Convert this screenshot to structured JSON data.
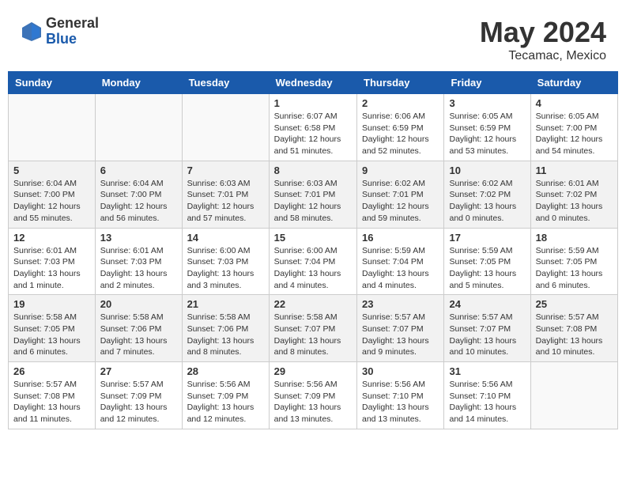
{
  "header": {
    "logo_general": "General",
    "logo_blue": "Blue",
    "month": "May 2024",
    "location": "Tecamac, Mexico"
  },
  "weekdays": [
    "Sunday",
    "Monday",
    "Tuesday",
    "Wednesday",
    "Thursday",
    "Friday",
    "Saturday"
  ],
  "weeks": [
    [
      {
        "day": "",
        "info": "",
        "shaded": false
      },
      {
        "day": "",
        "info": "",
        "shaded": false
      },
      {
        "day": "",
        "info": "",
        "shaded": false
      },
      {
        "day": "1",
        "info": "Sunrise: 6:07 AM\nSunset: 6:58 PM\nDaylight: 12 hours\nand 51 minutes.",
        "shaded": false
      },
      {
        "day": "2",
        "info": "Sunrise: 6:06 AM\nSunset: 6:59 PM\nDaylight: 12 hours\nand 52 minutes.",
        "shaded": false
      },
      {
        "day": "3",
        "info": "Sunrise: 6:05 AM\nSunset: 6:59 PM\nDaylight: 12 hours\nand 53 minutes.",
        "shaded": false
      },
      {
        "day": "4",
        "info": "Sunrise: 6:05 AM\nSunset: 7:00 PM\nDaylight: 12 hours\nand 54 minutes.",
        "shaded": false
      }
    ],
    [
      {
        "day": "5",
        "info": "Sunrise: 6:04 AM\nSunset: 7:00 PM\nDaylight: 12 hours\nand 55 minutes.",
        "shaded": true
      },
      {
        "day": "6",
        "info": "Sunrise: 6:04 AM\nSunset: 7:00 PM\nDaylight: 12 hours\nand 56 minutes.",
        "shaded": true
      },
      {
        "day": "7",
        "info": "Sunrise: 6:03 AM\nSunset: 7:01 PM\nDaylight: 12 hours\nand 57 minutes.",
        "shaded": true
      },
      {
        "day": "8",
        "info": "Sunrise: 6:03 AM\nSunset: 7:01 PM\nDaylight: 12 hours\nand 58 minutes.",
        "shaded": true
      },
      {
        "day": "9",
        "info": "Sunrise: 6:02 AM\nSunset: 7:01 PM\nDaylight: 12 hours\nand 59 minutes.",
        "shaded": true
      },
      {
        "day": "10",
        "info": "Sunrise: 6:02 AM\nSunset: 7:02 PM\nDaylight: 13 hours\nand 0 minutes.",
        "shaded": true
      },
      {
        "day": "11",
        "info": "Sunrise: 6:01 AM\nSunset: 7:02 PM\nDaylight: 13 hours\nand 0 minutes.",
        "shaded": true
      }
    ],
    [
      {
        "day": "12",
        "info": "Sunrise: 6:01 AM\nSunset: 7:03 PM\nDaylight: 13 hours\nand 1 minute.",
        "shaded": false
      },
      {
        "day": "13",
        "info": "Sunrise: 6:01 AM\nSunset: 7:03 PM\nDaylight: 13 hours\nand 2 minutes.",
        "shaded": false
      },
      {
        "day": "14",
        "info": "Sunrise: 6:00 AM\nSunset: 7:03 PM\nDaylight: 13 hours\nand 3 minutes.",
        "shaded": false
      },
      {
        "day": "15",
        "info": "Sunrise: 6:00 AM\nSunset: 7:04 PM\nDaylight: 13 hours\nand 4 minutes.",
        "shaded": false
      },
      {
        "day": "16",
        "info": "Sunrise: 5:59 AM\nSunset: 7:04 PM\nDaylight: 13 hours\nand 4 minutes.",
        "shaded": false
      },
      {
        "day": "17",
        "info": "Sunrise: 5:59 AM\nSunset: 7:05 PM\nDaylight: 13 hours\nand 5 minutes.",
        "shaded": false
      },
      {
        "day": "18",
        "info": "Sunrise: 5:59 AM\nSunset: 7:05 PM\nDaylight: 13 hours\nand 6 minutes.",
        "shaded": false
      }
    ],
    [
      {
        "day": "19",
        "info": "Sunrise: 5:58 AM\nSunset: 7:05 PM\nDaylight: 13 hours\nand 6 minutes.",
        "shaded": true
      },
      {
        "day": "20",
        "info": "Sunrise: 5:58 AM\nSunset: 7:06 PM\nDaylight: 13 hours\nand 7 minutes.",
        "shaded": true
      },
      {
        "day": "21",
        "info": "Sunrise: 5:58 AM\nSunset: 7:06 PM\nDaylight: 13 hours\nand 8 minutes.",
        "shaded": true
      },
      {
        "day": "22",
        "info": "Sunrise: 5:58 AM\nSunset: 7:07 PM\nDaylight: 13 hours\nand 8 minutes.",
        "shaded": true
      },
      {
        "day": "23",
        "info": "Sunrise: 5:57 AM\nSunset: 7:07 PM\nDaylight: 13 hours\nand 9 minutes.",
        "shaded": true
      },
      {
        "day": "24",
        "info": "Sunrise: 5:57 AM\nSunset: 7:07 PM\nDaylight: 13 hours\nand 10 minutes.",
        "shaded": true
      },
      {
        "day": "25",
        "info": "Sunrise: 5:57 AM\nSunset: 7:08 PM\nDaylight: 13 hours\nand 10 minutes.",
        "shaded": true
      }
    ],
    [
      {
        "day": "26",
        "info": "Sunrise: 5:57 AM\nSunset: 7:08 PM\nDaylight: 13 hours\nand 11 minutes.",
        "shaded": false
      },
      {
        "day": "27",
        "info": "Sunrise: 5:57 AM\nSunset: 7:09 PM\nDaylight: 13 hours\nand 12 minutes.",
        "shaded": false
      },
      {
        "day": "28",
        "info": "Sunrise: 5:56 AM\nSunset: 7:09 PM\nDaylight: 13 hours\nand 12 minutes.",
        "shaded": false
      },
      {
        "day": "29",
        "info": "Sunrise: 5:56 AM\nSunset: 7:09 PM\nDaylight: 13 hours\nand 13 minutes.",
        "shaded": false
      },
      {
        "day": "30",
        "info": "Sunrise: 5:56 AM\nSunset: 7:10 PM\nDaylight: 13 hours\nand 13 minutes.",
        "shaded": false
      },
      {
        "day": "31",
        "info": "Sunrise: 5:56 AM\nSunset: 7:10 PM\nDaylight: 13 hours\nand 14 minutes.",
        "shaded": false
      },
      {
        "day": "",
        "info": "",
        "shaded": false
      }
    ]
  ]
}
